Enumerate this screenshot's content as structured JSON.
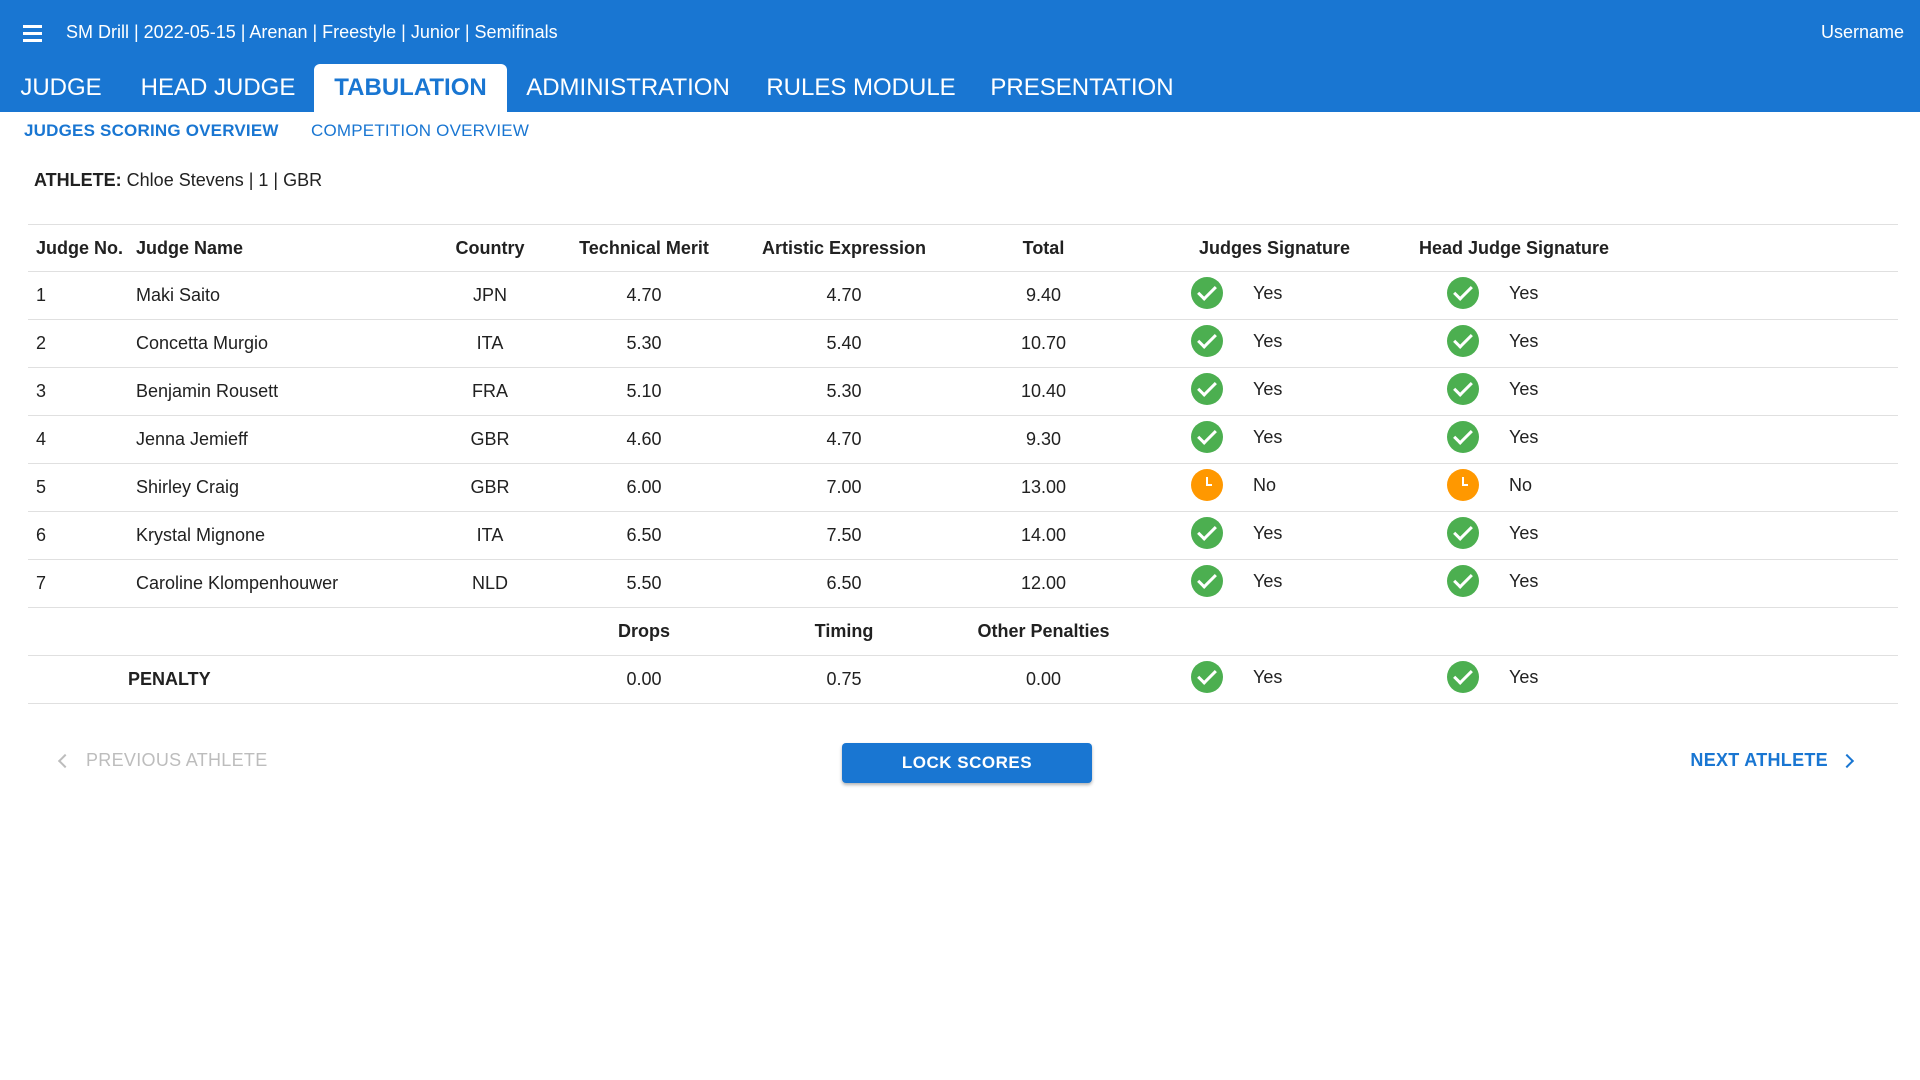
{
  "header": {
    "title": "SM Drill | 2022-05-15 | Arenan | Freestyle | Junior | Semifinals",
    "username": "Username",
    "menu_icon": "menu-icon"
  },
  "tabs": [
    "JUDGE",
    "HEAD JUDGE",
    "TABULATION",
    "ADMINISTRATION",
    "RULES MODULE",
    "PRESENTATION"
  ],
  "active_tab": "TABULATION",
  "subtabs": [
    "JUDGES SCORING OVERVIEW",
    "COMPETITION OVERVIEW"
  ],
  "active_subtab": "JUDGES SCORING OVERVIEW",
  "athlete": {
    "label": "ATHLETE:",
    "value": "Chloe Stevens | 1 | GBR"
  },
  "table": {
    "columns": [
      "Judge No.",
      "Judge Name",
      "Country",
      "Technical Merit",
      "Artistic Expression",
      "Total",
      "Judges Signature",
      "Head Judge Signature"
    ],
    "rows": [
      {
        "no": "1",
        "name": "Maki Saito",
        "country": "JPN",
        "technical": "4.70",
        "artistic": "4.70",
        "total": "9.40",
        "judge_sig": "Yes",
        "head_sig": "Yes"
      },
      {
        "no": "2",
        "name": "Concetta Murgio",
        "country": "ITA",
        "technical": "5.30",
        "artistic": "5.40",
        "total": "10.70",
        "judge_sig": "Yes",
        "head_sig": "Yes"
      },
      {
        "no": "3",
        "name": "Benjamin Rousett",
        "country": "FRA",
        "technical": "5.10",
        "artistic": "5.30",
        "total": "10.40",
        "judge_sig": "Yes",
        "head_sig": "Yes"
      },
      {
        "no": "4",
        "name": "Jenna Jemieff",
        "country": "GBR",
        "technical": "4.60",
        "artistic": "4.70",
        "total": "9.30",
        "judge_sig": "Yes",
        "head_sig": "Yes"
      },
      {
        "no": "5",
        "name": "Shirley Craig",
        "country": "GBR",
        "technical": "6.00",
        "artistic": "7.00",
        "total": "13.00",
        "judge_sig": "No",
        "head_sig": "No"
      },
      {
        "no": "6",
        "name": "Krystal Mignone",
        "country": "ITA",
        "technical": "6.50",
        "artistic": "7.50",
        "total": "14.00",
        "judge_sig": "Yes",
        "head_sig": "Yes"
      },
      {
        "no": "7",
        "name": "Caroline Klompenhouwer",
        "country": "NLD",
        "technical": "5.50",
        "artistic": "6.50",
        "total": "12.00",
        "judge_sig": "Yes",
        "head_sig": "Yes"
      }
    ],
    "penalty_columns": [
      "Drops",
      "Timing",
      "Other Penalties"
    ],
    "penalty": {
      "label": "PENALTY",
      "drops": "0.00",
      "timing": "0.75",
      "other": "0.00",
      "judge_sig": "Yes",
      "head_sig": "Yes"
    }
  },
  "actions": {
    "previous": "PREVIOUS ATHLETE",
    "lock": "LOCK SCORES",
    "next": "NEXT ATHLETE"
  },
  "colors": {
    "primary": "#1976d2",
    "signed": "#4caf50",
    "pending": "#ff9800",
    "disabled": "#bdbdbd"
  }
}
